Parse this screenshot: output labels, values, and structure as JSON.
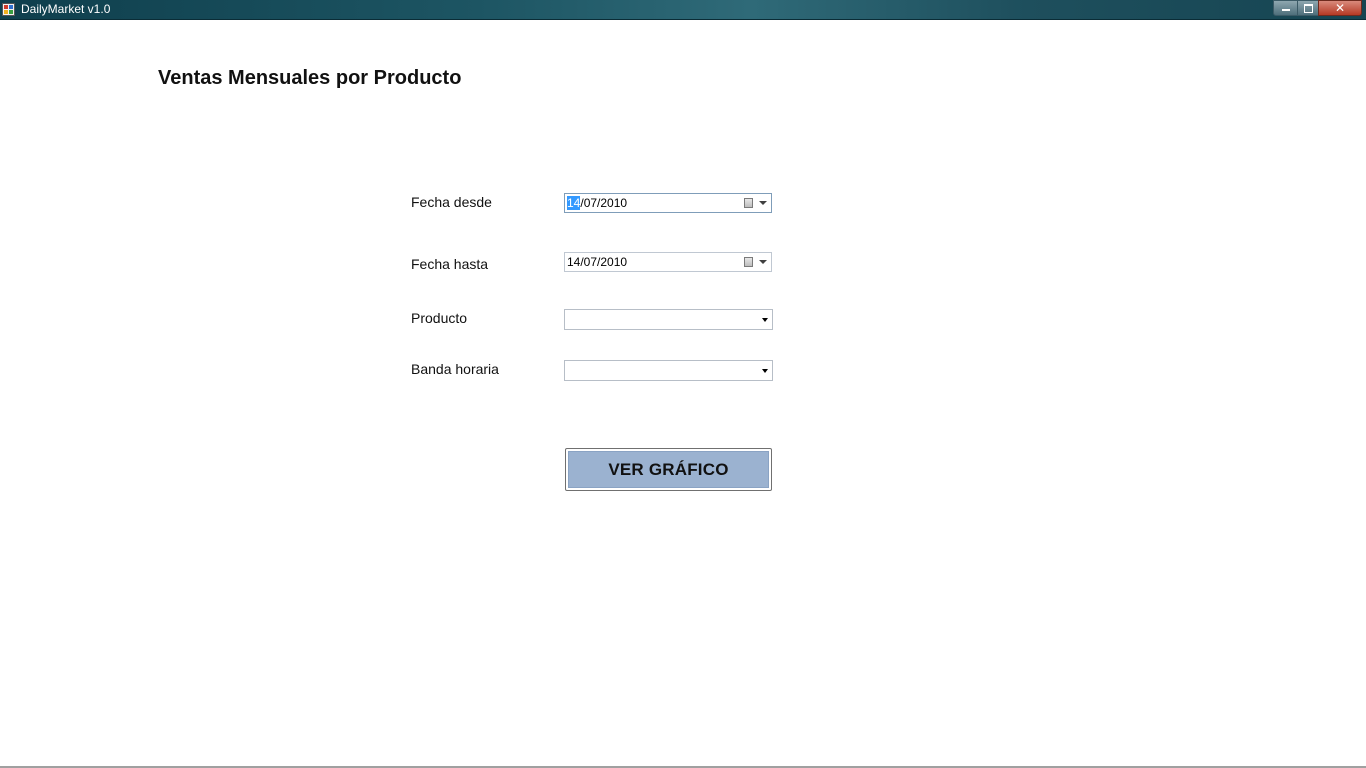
{
  "window": {
    "title": "DailyMarket v1.0",
    "minimize_label": "",
    "maximize_label": "",
    "close_label": "✕"
  },
  "page": {
    "title": "Ventas Mensuales por Producto"
  },
  "form": {
    "fecha_desde": {
      "label": "Fecha desde",
      "value_selected": "14",
      "value_rest": "/07/2010"
    },
    "fecha_hasta": {
      "label": "Fecha hasta",
      "value": "14/07/2010"
    },
    "producto": {
      "label": "Producto",
      "value": ""
    },
    "banda_horaria": {
      "label": "Banda horaria",
      "value": ""
    },
    "submit_label": "VER GRÁFICO"
  },
  "icons": {
    "app": "app-icon",
    "calendar": "calendar-icon",
    "dropdown": "chevron-down-icon"
  },
  "colors": {
    "titlebar": "#1d5563",
    "button_fill": "#9bb2d0",
    "selection": "#3399ff"
  }
}
